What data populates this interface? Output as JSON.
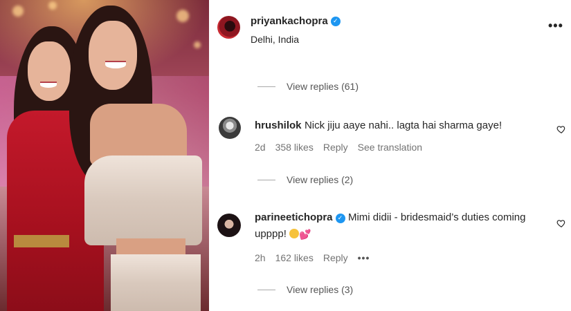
{
  "post": {
    "username": "priyankachopra",
    "location": "Delhi, India",
    "more_icon": "more-horizontal-icon"
  },
  "replies_61": "View replies (61)",
  "comments": [
    {
      "username": "hrushilok",
      "text": "Nick jiju aaye nahi.. lagta hai sharma gaye!",
      "time": "2d",
      "likes": "358 likes",
      "reply": "Reply",
      "translate": "See translation",
      "view_replies": "View replies (2)"
    },
    {
      "username": "parineetichopra",
      "text_line1": "Mimi didii - bridesmaid’s duties coming",
      "text_line2": "upppp!",
      "time": "2h",
      "likes": "162 likes",
      "reply": "Reply",
      "more": "•••",
      "view_replies": "View replies (3)"
    }
  ],
  "colors": {
    "verified": "#1d96f1",
    "text": "#262626",
    "muted": "#737373"
  }
}
